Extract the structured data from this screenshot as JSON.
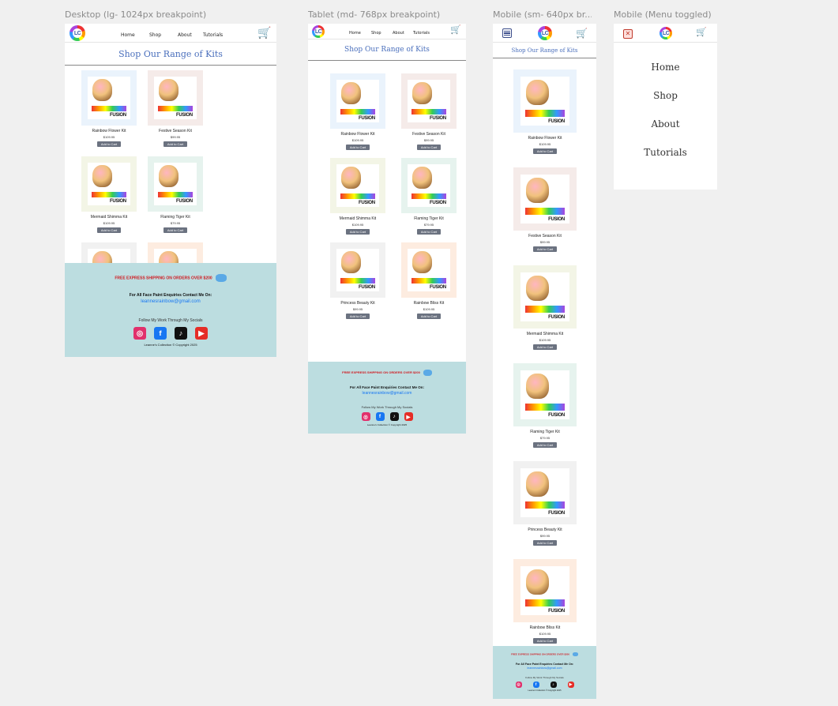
{
  "labels": {
    "desktop": "Desktop (lg- 1024px breakpoint)",
    "tablet": "Tablet (md- 768px breakpoint)",
    "mobile": "Mobile (sm- 640px br...",
    "mobile_menu": "Mobile (Menu toggled)"
  },
  "logo_text": "LC",
  "nav": [
    "Home",
    "Shop",
    "About",
    "Tutorials"
  ],
  "page_title": "Shop Our Range of Kits",
  "brand_text": "FUSION",
  "products": [
    {
      "name": "Rainbow Flower Kit",
      "price": "$109.95",
      "button": "Add to Cart",
      "bg": "#eaf3fc"
    },
    {
      "name": "Festive Season Kit",
      "price": "$99.95",
      "button": "Add to Cart",
      "bg": "#f5ebe9"
    },
    {
      "name": "Mermaid Shimma Kit",
      "price": "$109.95",
      "button": "Add to Cart",
      "bg": "#f3f5e6"
    },
    {
      "name": "Flaming Tiger Kit",
      "price": "$79.95",
      "button": "Add to Cart",
      "bg": "#e6f3ee"
    },
    {
      "name": "Princess Beauty Kit",
      "price": "$99.95",
      "button": "Add to Cart",
      "bg": "#f1f1f1"
    },
    {
      "name": "Rainbow Bliss Kit",
      "price": "$109.95",
      "button": "Add to Cart",
      "bg": "#fdece0"
    }
  ],
  "footer": {
    "shipping": "FREE EXPRESS SHIPPING ON ORDERS OVER $200",
    "contact": "For All Face Paint Enquiries Contact Me On:",
    "email": "leannesrainbow@gmail.com",
    "follow": "Follow My Work Through My Socials",
    "socials": [
      {
        "icon": "instagram-icon",
        "glyph": "◎",
        "color": "#e1306c"
      },
      {
        "icon": "facebook-icon",
        "glyph": "f",
        "color": "#1877f2"
      },
      {
        "icon": "tiktok-icon",
        "glyph": "♪",
        "color": "#111111"
      },
      {
        "icon": "youtube-icon",
        "glyph": "▶",
        "color": "#e52d27"
      }
    ],
    "copyright": "Leanne's Collection © Copyright 2025"
  },
  "mobile_menu": {
    "close_icon": "✕",
    "items": [
      "Home",
      "Shop",
      "About",
      "Tutorials"
    ]
  },
  "colors": {
    "title": "#4a6fbc",
    "footer_bg": "#bcdde0",
    "button": "#6b7280",
    "shipping": "#d0191f",
    "email": "#1877f2"
  }
}
